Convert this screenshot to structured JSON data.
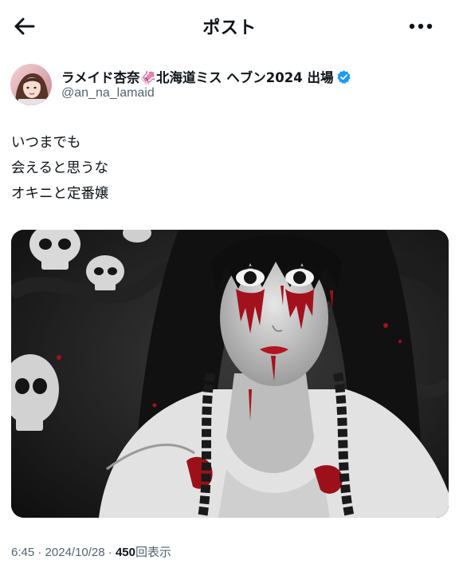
{
  "header": {
    "title": "ポスト",
    "back_icon": "arrow-left-icon",
    "more_icon": "more-horizontal-icon"
  },
  "author": {
    "display_name": "ラメイド杏奈🦑北海道ミス ヘブン2024 出場",
    "handle": "@an_na_lamaid",
    "verified": true,
    "verified_color": "#1d9bf0"
  },
  "post": {
    "lines": [
      "いつまでも",
      "会えると思うな",
      "オキニと定番嬢"
    ]
  },
  "meta": {
    "time": "6:45",
    "separator": "·",
    "date": "2024/10/28",
    "views_count": "450",
    "views_label": "回表示"
  }
}
